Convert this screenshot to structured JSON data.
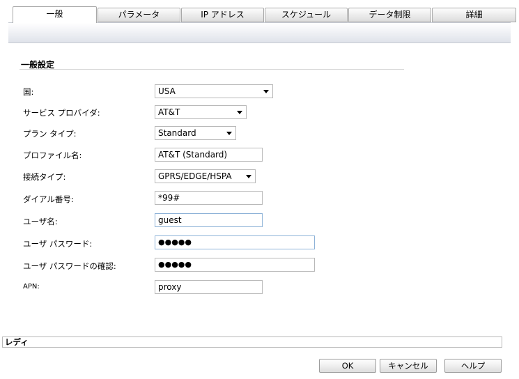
{
  "tabs": [
    {
      "label": "一般",
      "active": true
    },
    {
      "label": "パラメータ",
      "active": false
    },
    {
      "label": "IP アドレス",
      "active": false
    },
    {
      "label": "スケジュール",
      "active": false
    },
    {
      "label": "データ制限",
      "active": false
    },
    {
      "label": "詳細",
      "active": false
    }
  ],
  "section": {
    "title": "一般設定"
  },
  "fields": {
    "country": {
      "label": "国:",
      "value": "USA"
    },
    "provider": {
      "label": "サービス プロバイダ:",
      "value": "AT&T"
    },
    "plan_type": {
      "label": "プラン タイプ:",
      "value": "Standard"
    },
    "profile_name": {
      "label": "プロファイル名:",
      "value": "AT&T (Standard)"
    },
    "connection_type": {
      "label": "接続タイプ:",
      "value": "GPRS/EDGE/HSPA"
    },
    "dial_number": {
      "label": "ダイアル番号:",
      "value": "*99#"
    },
    "username": {
      "label": "ユーザ名:",
      "value": "guest"
    },
    "password": {
      "label": "ユーザ パスワード:",
      "value": "●●●●●"
    },
    "password_confirm": {
      "label": "ユーザ パスワードの確認:",
      "value": "●●●●●"
    },
    "apn": {
      "label": "APN:",
      "value": "proxy"
    }
  },
  "status": {
    "text": "レディ"
  },
  "buttons": {
    "ok": "OK",
    "cancel": "キャンセル",
    "help": "ヘルプ"
  }
}
